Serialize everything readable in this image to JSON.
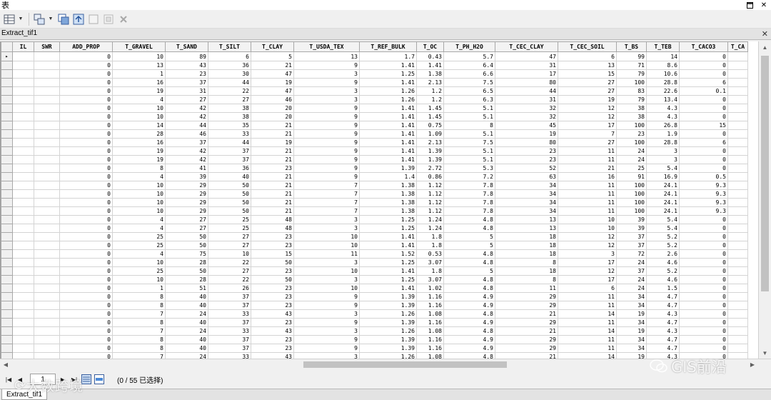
{
  "window": {
    "title": "表"
  },
  "tab": {
    "label": "Extract_tif1"
  },
  "bottom_tab": {
    "label": "Extract_tif1"
  },
  "status": {
    "record": "1",
    "selection": "(0 / 55 已选择)"
  },
  "watermark": {
    "left": "大数跨境",
    "right": "GIS前沿"
  },
  "columns": [
    "IL",
    "SWR",
    "ADD_PROP",
    "T_GRAVEL",
    "T_SAND",
    "T_SILT",
    "T_CLAY",
    "T_USDA_TEX",
    "T_REF_BULK",
    "T_OC",
    "T_PH_H2O",
    "T_CEC_CLAY",
    "T_CEC_SOIL",
    "T_BS",
    "T_TEB",
    "T_CACO3",
    "T_CA"
  ],
  "rows": [
    [
      "",
      "",
      "0",
      "10",
      "89",
      "6",
      "5",
      "13",
      "1.7",
      "0.43",
      "5.7",
      "47",
      "6",
      "99",
      "14",
      "0",
      ""
    ],
    [
      "",
      "",
      "0",
      "13",
      "43",
      "36",
      "21",
      "9",
      "1.41",
      "1.41",
      "6.4",
      "31",
      "13",
      "71",
      "8.6",
      "0",
      ""
    ],
    [
      "",
      "",
      "0",
      "1",
      "23",
      "30",
      "47",
      "3",
      "1.25",
      "1.38",
      "6.6",
      "17",
      "15",
      "79",
      "10.6",
      "0",
      ""
    ],
    [
      "",
      "",
      "0",
      "16",
      "37",
      "44",
      "19",
      "9",
      "1.41",
      "2.13",
      "7.5",
      "80",
      "27",
      "100",
      "28.8",
      "6",
      ""
    ],
    [
      "",
      "",
      "0",
      "19",
      "31",
      "22",
      "47",
      "3",
      "1.26",
      "1.2",
      "6.5",
      "44",
      "27",
      "83",
      "22.6",
      "0.1",
      ""
    ],
    [
      "",
      "",
      "0",
      "4",
      "27",
      "27",
      "46",
      "3",
      "1.26",
      "1.2",
      "6.3",
      "31",
      "19",
      "79",
      "13.4",
      "0",
      ""
    ],
    [
      "",
      "",
      "0",
      "10",
      "42",
      "38",
      "20",
      "9",
      "1.41",
      "1.45",
      "5.1",
      "32",
      "12",
      "38",
      "4.3",
      "0",
      ""
    ],
    [
      "",
      "",
      "0",
      "10",
      "42",
      "38",
      "20",
      "9",
      "1.41",
      "1.45",
      "5.1",
      "32",
      "12",
      "38",
      "4.3",
      "0",
      ""
    ],
    [
      "",
      "",
      "0",
      "14",
      "44",
      "35",
      "21",
      "9",
      "1.41",
      "0.75",
      "8",
      "45",
      "17",
      "100",
      "26.8",
      "15",
      ""
    ],
    [
      "",
      "",
      "0",
      "28",
      "46",
      "33",
      "21",
      "9",
      "1.41",
      "1.09",
      "5.1",
      "19",
      "7",
      "23",
      "1.9",
      "0",
      ""
    ],
    [
      "",
      "",
      "0",
      "16",
      "37",
      "44",
      "19",
      "9",
      "1.41",
      "2.13",
      "7.5",
      "80",
      "27",
      "100",
      "28.8",
      "6",
      ""
    ],
    [
      "",
      "",
      "0",
      "19",
      "42",
      "37",
      "21",
      "9",
      "1.41",
      "1.39",
      "5.1",
      "23",
      "11",
      "24",
      "3",
      "0",
      ""
    ],
    [
      "",
      "",
      "0",
      "19",
      "42",
      "37",
      "21",
      "9",
      "1.41",
      "1.39",
      "5.1",
      "23",
      "11",
      "24",
      "3",
      "0",
      ""
    ],
    [
      "",
      "",
      "0",
      "8",
      "41",
      "36",
      "23",
      "9",
      "1.39",
      "2.72",
      "5.3",
      "52",
      "21",
      "25",
      "5.4",
      "0",
      ""
    ],
    [
      "",
      "",
      "0",
      "4",
      "39",
      "40",
      "21",
      "9",
      "1.4",
      "0.86",
      "7.2",
      "63",
      "16",
      "91",
      "16.9",
      "0.5",
      ""
    ],
    [
      "",
      "",
      "0",
      "10",
      "29",
      "50",
      "21",
      "7",
      "1.38",
      "1.12",
      "7.8",
      "34",
      "11",
      "100",
      "24.1",
      "9.3",
      ""
    ],
    [
      "",
      "",
      "0",
      "10",
      "29",
      "50",
      "21",
      "7",
      "1.38",
      "1.12",
      "7.8",
      "34",
      "11",
      "100",
      "24.1",
      "9.3",
      ""
    ],
    [
      "",
      "",
      "0",
      "10",
      "29",
      "50",
      "21",
      "7",
      "1.38",
      "1.12",
      "7.8",
      "34",
      "11",
      "100",
      "24.1",
      "9.3",
      ""
    ],
    [
      "",
      "",
      "0",
      "10",
      "29",
      "50",
      "21",
      "7",
      "1.38",
      "1.12",
      "7.8",
      "34",
      "11",
      "100",
      "24.1",
      "9.3",
      ""
    ],
    [
      "",
      "",
      "0",
      "4",
      "27",
      "25",
      "48",
      "3",
      "1.25",
      "1.24",
      "4.8",
      "13",
      "10",
      "39",
      "5.4",
      "0",
      ""
    ],
    [
      "",
      "",
      "0",
      "4",
      "27",
      "25",
      "48",
      "3",
      "1.25",
      "1.24",
      "4.8",
      "13",
      "10",
      "39",
      "5.4",
      "0",
      ""
    ],
    [
      "",
      "",
      "0",
      "25",
      "50",
      "27",
      "23",
      "10",
      "1.41",
      "1.8",
      "5",
      "18",
      "12",
      "37",
      "5.2",
      "0",
      ""
    ],
    [
      "",
      "",
      "0",
      "25",
      "50",
      "27",
      "23",
      "10",
      "1.41",
      "1.8",
      "5",
      "18",
      "12",
      "37",
      "5.2",
      "0",
      ""
    ],
    [
      "",
      "",
      "0",
      "4",
      "75",
      "10",
      "15",
      "11",
      "1.52",
      "0.53",
      "4.8",
      "18",
      "3",
      "72",
      "2.6",
      "0",
      ""
    ],
    [
      "",
      "",
      "0",
      "10",
      "28",
      "22",
      "50",
      "3",
      "1.25",
      "3.07",
      "4.8",
      "8",
      "17",
      "24",
      "4.6",
      "0",
      ""
    ],
    [
      "",
      "",
      "0",
      "25",
      "50",
      "27",
      "23",
      "10",
      "1.41",
      "1.8",
      "5",
      "18",
      "12",
      "37",
      "5.2",
      "0",
      ""
    ],
    [
      "",
      "",
      "0",
      "10",
      "28",
      "22",
      "50",
      "3",
      "1.25",
      "3.07",
      "4.8",
      "8",
      "17",
      "24",
      "4.6",
      "0",
      ""
    ],
    [
      "",
      "",
      "0",
      "1",
      "51",
      "26",
      "23",
      "10",
      "1.41",
      "1.02",
      "4.8",
      "11",
      "6",
      "24",
      "1.5",
      "0",
      ""
    ],
    [
      "",
      "",
      "0",
      "8",
      "40",
      "37",
      "23",
      "9",
      "1.39",
      "1.16",
      "4.9",
      "29",
      "11",
      "34",
      "4.7",
      "0",
      ""
    ],
    [
      "",
      "",
      "0",
      "8",
      "40",
      "37",
      "23",
      "9",
      "1.39",
      "1.16",
      "4.9",
      "29",
      "11",
      "34",
      "4.7",
      "0",
      ""
    ],
    [
      "",
      "",
      "0",
      "7",
      "24",
      "33",
      "43",
      "3",
      "1.26",
      "1.08",
      "4.8",
      "21",
      "14",
      "19",
      "4.3",
      "0",
      ""
    ],
    [
      "",
      "",
      "0",
      "8",
      "40",
      "37",
      "23",
      "9",
      "1.39",
      "1.16",
      "4.9",
      "29",
      "11",
      "34",
      "4.7",
      "0",
      ""
    ],
    [
      "",
      "",
      "0",
      "7",
      "24",
      "33",
      "43",
      "3",
      "1.26",
      "1.08",
      "4.8",
      "21",
      "14",
      "19",
      "4.3",
      "0",
      ""
    ],
    [
      "",
      "",
      "0",
      "8",
      "40",
      "37",
      "23",
      "9",
      "1.39",
      "1.16",
      "4.9",
      "29",
      "11",
      "34",
      "4.7",
      "0",
      ""
    ],
    [
      "",
      "",
      "0",
      "8",
      "40",
      "37",
      "23",
      "9",
      "1.39",
      "1.16",
      "4.9",
      "29",
      "11",
      "34",
      "4.7",
      "0",
      ""
    ],
    [
      "",
      "",
      "0",
      "7",
      "24",
      "33",
      "43",
      "3",
      "1.26",
      "1.08",
      "4.8",
      "21",
      "14",
      "19",
      "4.3",
      "0",
      ""
    ]
  ],
  "icons": {
    "table_options": "table-options-icon",
    "related_tables": "related-tables-icon",
    "select_by_attributes": "select-by-attributes-icon",
    "switch_selection": "switch-selection-icon",
    "clear_selection": "clear-selection-icon",
    "zoom_to_selected": "zoom-to-selected-icon",
    "delete_selected": "delete-selected-icon"
  }
}
